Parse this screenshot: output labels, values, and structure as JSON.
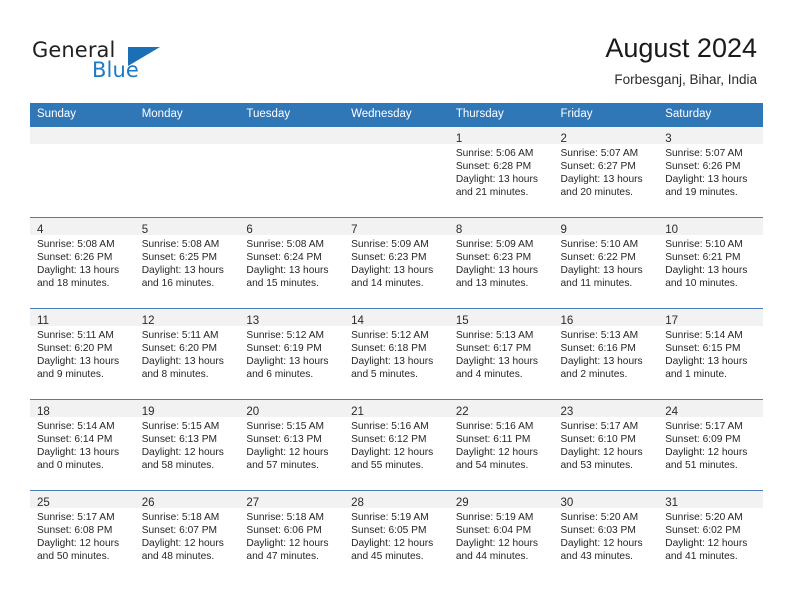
{
  "logo": {
    "word_one": "General",
    "word_two": "Blue",
    "triangle_icon": "triangle-icon",
    "accent_color": "#1a6fb5"
  },
  "header": {
    "title": "August 2024",
    "subtitle": "Forbesganj, Bihar, India"
  },
  "theme": {
    "header_blue": "#3077b8",
    "daynum_band": "#f2f2f2",
    "row_divider": "#4a7ebb"
  },
  "weekday_headers": [
    "Sunday",
    "Monday",
    "Tuesday",
    "Wednesday",
    "Thursday",
    "Friday",
    "Saturday"
  ],
  "weeks": [
    [
      {
        "day": "",
        "sunrise": "",
        "sunset": "",
        "daylight_line1": "",
        "daylight_line2": "",
        "empty": true
      },
      {
        "day": "",
        "sunrise": "",
        "sunset": "",
        "daylight_line1": "",
        "daylight_line2": "",
        "empty": true
      },
      {
        "day": "",
        "sunrise": "",
        "sunset": "",
        "daylight_line1": "",
        "daylight_line2": "",
        "empty": true
      },
      {
        "day": "",
        "sunrise": "",
        "sunset": "",
        "daylight_line1": "",
        "daylight_line2": "",
        "empty": true
      },
      {
        "day": "1",
        "sunrise": "Sunrise: 5:06 AM",
        "sunset": "Sunset: 6:28 PM",
        "daylight_line1": "Daylight: 13 hours",
        "daylight_line2": "and 21 minutes."
      },
      {
        "day": "2",
        "sunrise": "Sunrise: 5:07 AM",
        "sunset": "Sunset: 6:27 PM",
        "daylight_line1": "Daylight: 13 hours",
        "daylight_line2": "and 20 minutes."
      },
      {
        "day": "3",
        "sunrise": "Sunrise: 5:07 AM",
        "sunset": "Sunset: 6:26 PM",
        "daylight_line1": "Daylight: 13 hours",
        "daylight_line2": "and 19 minutes."
      }
    ],
    [
      {
        "day": "4",
        "sunrise": "Sunrise: 5:08 AM",
        "sunset": "Sunset: 6:26 PM",
        "daylight_line1": "Daylight: 13 hours",
        "daylight_line2": "and 18 minutes."
      },
      {
        "day": "5",
        "sunrise": "Sunrise: 5:08 AM",
        "sunset": "Sunset: 6:25 PM",
        "daylight_line1": "Daylight: 13 hours",
        "daylight_line2": "and 16 minutes."
      },
      {
        "day": "6",
        "sunrise": "Sunrise: 5:08 AM",
        "sunset": "Sunset: 6:24 PM",
        "daylight_line1": "Daylight: 13 hours",
        "daylight_line2": "and 15 minutes."
      },
      {
        "day": "7",
        "sunrise": "Sunrise: 5:09 AM",
        "sunset": "Sunset: 6:23 PM",
        "daylight_line1": "Daylight: 13 hours",
        "daylight_line2": "and 14 minutes."
      },
      {
        "day": "8",
        "sunrise": "Sunrise: 5:09 AM",
        "sunset": "Sunset: 6:23 PM",
        "daylight_line1": "Daylight: 13 hours",
        "daylight_line2": "and 13 minutes."
      },
      {
        "day": "9",
        "sunrise": "Sunrise: 5:10 AM",
        "sunset": "Sunset: 6:22 PM",
        "daylight_line1": "Daylight: 13 hours",
        "daylight_line2": "and 11 minutes."
      },
      {
        "day": "10",
        "sunrise": "Sunrise: 5:10 AM",
        "sunset": "Sunset: 6:21 PM",
        "daylight_line1": "Daylight: 13 hours",
        "daylight_line2": "and 10 minutes."
      }
    ],
    [
      {
        "day": "11",
        "sunrise": "Sunrise: 5:11 AM",
        "sunset": "Sunset: 6:20 PM",
        "daylight_line1": "Daylight: 13 hours",
        "daylight_line2": "and 9 minutes."
      },
      {
        "day": "12",
        "sunrise": "Sunrise: 5:11 AM",
        "sunset": "Sunset: 6:20 PM",
        "daylight_line1": "Daylight: 13 hours",
        "daylight_line2": "and 8 minutes."
      },
      {
        "day": "13",
        "sunrise": "Sunrise: 5:12 AM",
        "sunset": "Sunset: 6:19 PM",
        "daylight_line1": "Daylight: 13 hours",
        "daylight_line2": "and 6 minutes."
      },
      {
        "day": "14",
        "sunrise": "Sunrise: 5:12 AM",
        "sunset": "Sunset: 6:18 PM",
        "daylight_line1": "Daylight: 13 hours",
        "daylight_line2": "and 5 minutes."
      },
      {
        "day": "15",
        "sunrise": "Sunrise: 5:13 AM",
        "sunset": "Sunset: 6:17 PM",
        "daylight_line1": "Daylight: 13 hours",
        "daylight_line2": "and 4 minutes."
      },
      {
        "day": "16",
        "sunrise": "Sunrise: 5:13 AM",
        "sunset": "Sunset: 6:16 PM",
        "daylight_line1": "Daylight: 13 hours",
        "daylight_line2": "and 2 minutes."
      },
      {
        "day": "17",
        "sunrise": "Sunrise: 5:14 AM",
        "sunset": "Sunset: 6:15 PM",
        "daylight_line1": "Daylight: 13 hours",
        "daylight_line2": "and 1 minute."
      }
    ],
    [
      {
        "day": "18",
        "sunrise": "Sunrise: 5:14 AM",
        "sunset": "Sunset: 6:14 PM",
        "daylight_line1": "Daylight: 13 hours",
        "daylight_line2": "and 0 minutes."
      },
      {
        "day": "19",
        "sunrise": "Sunrise: 5:15 AM",
        "sunset": "Sunset: 6:13 PM",
        "daylight_line1": "Daylight: 12 hours",
        "daylight_line2": "and 58 minutes."
      },
      {
        "day": "20",
        "sunrise": "Sunrise: 5:15 AM",
        "sunset": "Sunset: 6:13 PM",
        "daylight_line1": "Daylight: 12 hours",
        "daylight_line2": "and 57 minutes."
      },
      {
        "day": "21",
        "sunrise": "Sunrise: 5:16 AM",
        "sunset": "Sunset: 6:12 PM",
        "daylight_line1": "Daylight: 12 hours",
        "daylight_line2": "and 55 minutes."
      },
      {
        "day": "22",
        "sunrise": "Sunrise: 5:16 AM",
        "sunset": "Sunset: 6:11 PM",
        "daylight_line1": "Daylight: 12 hours",
        "daylight_line2": "and 54 minutes."
      },
      {
        "day": "23",
        "sunrise": "Sunrise: 5:17 AM",
        "sunset": "Sunset: 6:10 PM",
        "daylight_line1": "Daylight: 12 hours",
        "daylight_line2": "and 53 minutes."
      },
      {
        "day": "24",
        "sunrise": "Sunrise: 5:17 AM",
        "sunset": "Sunset: 6:09 PM",
        "daylight_line1": "Daylight: 12 hours",
        "daylight_line2": "and 51 minutes."
      }
    ],
    [
      {
        "day": "25",
        "sunrise": "Sunrise: 5:17 AM",
        "sunset": "Sunset: 6:08 PM",
        "daylight_line1": "Daylight: 12 hours",
        "daylight_line2": "and 50 minutes."
      },
      {
        "day": "26",
        "sunrise": "Sunrise: 5:18 AM",
        "sunset": "Sunset: 6:07 PM",
        "daylight_line1": "Daylight: 12 hours",
        "daylight_line2": "and 48 minutes."
      },
      {
        "day": "27",
        "sunrise": "Sunrise: 5:18 AM",
        "sunset": "Sunset: 6:06 PM",
        "daylight_line1": "Daylight: 12 hours",
        "daylight_line2": "and 47 minutes."
      },
      {
        "day": "28",
        "sunrise": "Sunrise: 5:19 AM",
        "sunset": "Sunset: 6:05 PM",
        "daylight_line1": "Daylight: 12 hours",
        "daylight_line2": "and 45 minutes."
      },
      {
        "day": "29",
        "sunrise": "Sunrise: 5:19 AM",
        "sunset": "Sunset: 6:04 PM",
        "daylight_line1": "Daylight: 12 hours",
        "daylight_line2": "and 44 minutes."
      },
      {
        "day": "30",
        "sunrise": "Sunrise: 5:20 AM",
        "sunset": "Sunset: 6:03 PM",
        "daylight_line1": "Daylight: 12 hours",
        "daylight_line2": "and 43 minutes."
      },
      {
        "day": "31",
        "sunrise": "Sunrise: 5:20 AM",
        "sunset": "Sunset: 6:02 PM",
        "daylight_line1": "Daylight: 12 hours",
        "daylight_line2": "and 41 minutes."
      }
    ]
  ]
}
